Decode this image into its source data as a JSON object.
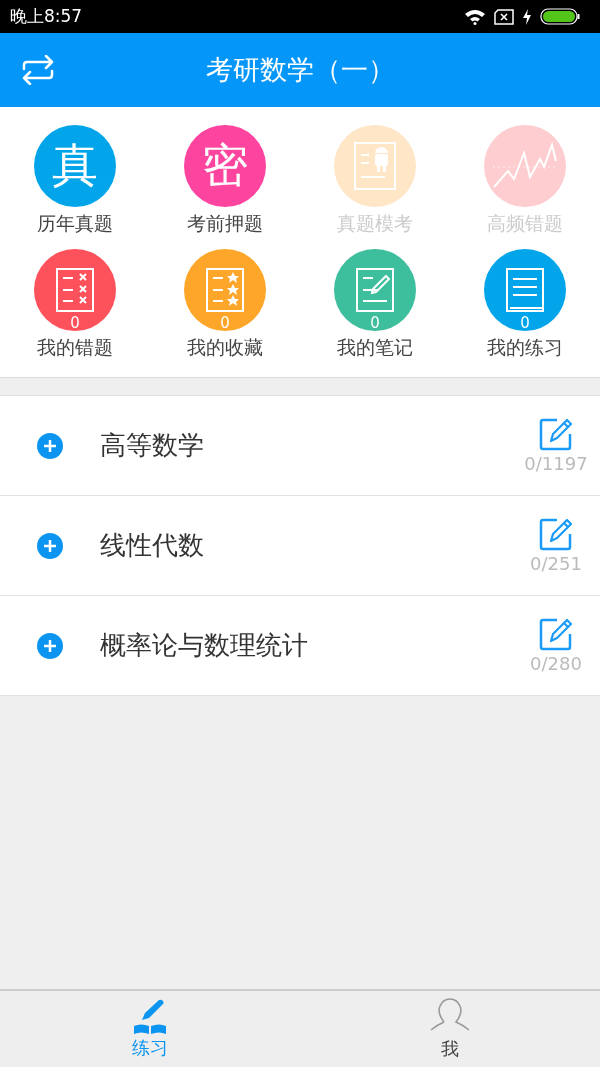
{
  "status_bar": {
    "time": "晚上8:57"
  },
  "header": {
    "title": "考研数学（一）"
  },
  "grid": [
    {
      "label": "历年真题",
      "kind": "glyph",
      "glyph": "真",
      "color": "#03a5ea",
      "disabled": false
    },
    {
      "label": "考前押题",
      "kind": "glyph",
      "glyph": "密",
      "color": "#fd45a0",
      "disabled": false
    },
    {
      "label": "真题模考",
      "kind": "android-doc",
      "color": "#fee6c6",
      "disabled": true
    },
    {
      "label": "高频错题",
      "kind": "chart",
      "color": "#fecdd0",
      "disabled": true
    },
    {
      "label": "我的错题",
      "kind": "cross-list",
      "color": "#fd525b",
      "count": "0",
      "disabled": false
    },
    {
      "label": "我的收藏",
      "kind": "star-list",
      "color": "#fea62a",
      "count": "0",
      "disabled": false
    },
    {
      "label": "我的笔记",
      "kind": "note",
      "color": "#3dbe9c",
      "count": "0",
      "disabled": false
    },
    {
      "label": "我的练习",
      "kind": "book",
      "color": "#03a5ea",
      "count": "0",
      "disabled": false
    }
  ],
  "subjects": [
    {
      "name": "高等数学",
      "progress": "0/1197"
    },
    {
      "name": "线性代数",
      "progress": "0/251"
    },
    {
      "name": "概率论与数理统计",
      "progress": "0/280"
    }
  ],
  "bottom_nav": [
    {
      "label": "练习",
      "kind": "practice",
      "selected": true
    },
    {
      "label": "我",
      "kind": "profile",
      "selected": false
    }
  ]
}
